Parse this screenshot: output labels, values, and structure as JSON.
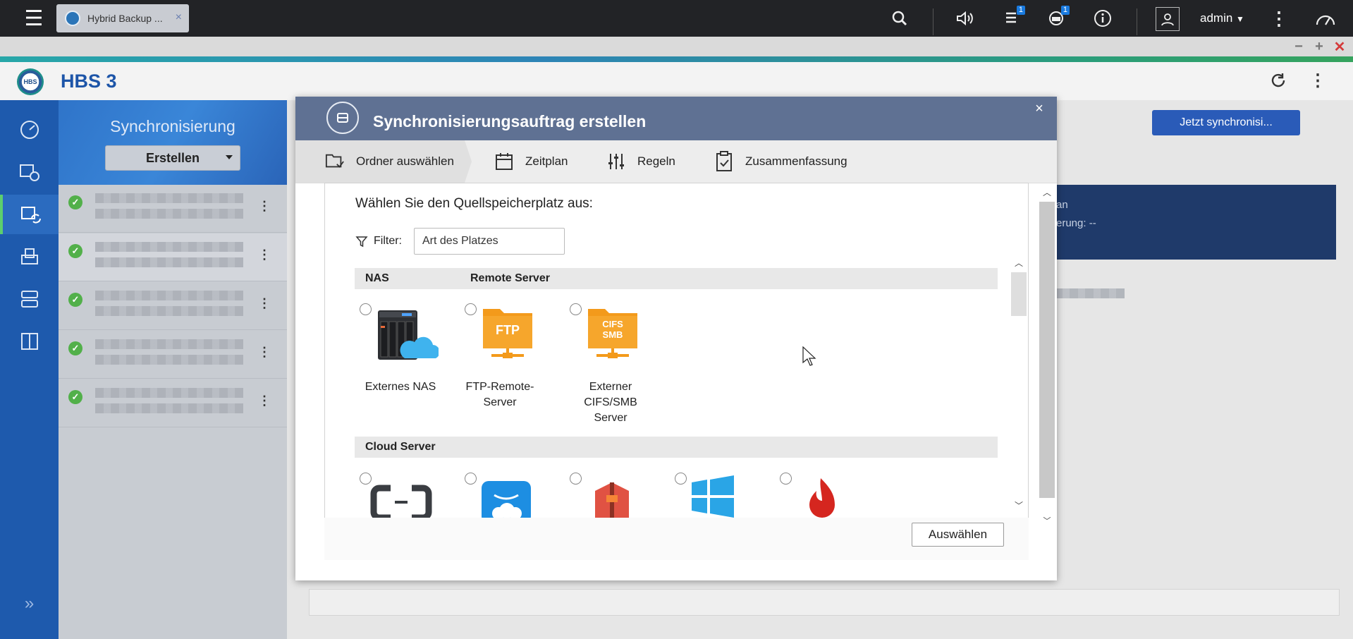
{
  "topbar": {
    "menu_icon": "hamburger-menu-icon",
    "tab_label": "Hybrid Backup ...",
    "tab_close": "×",
    "notifications": [
      {
        "icon": "tasks-icon",
        "count": "1"
      },
      {
        "icon": "event-icon",
        "count": "1"
      }
    ],
    "user": "admin"
  },
  "window_controls": {
    "minimize": "−",
    "maximize": "+",
    "close": "✕"
  },
  "app": {
    "logo_text": "HBS",
    "title": "HBS 3"
  },
  "left_nav": [
    "overview-icon",
    "backup-restore-icon",
    "sync-icon",
    "services-icon",
    "storage-spaces-icon",
    "logs-icon"
  ],
  "side_panel": {
    "title": "Synchronisierung",
    "create_button": "Erstellen",
    "jobs_count": 5
  },
  "main": {
    "sync_now_button": "Jetzt synchronisi...",
    "info_line1": "an",
    "info_line2": "erung: --"
  },
  "dialog": {
    "title": "Synchronisierungsauftrag erstellen",
    "close": "×",
    "steps": [
      {
        "label": "Ordner auswählen",
        "active": true
      },
      {
        "label": "Zeitplan",
        "active": false
      },
      {
        "label": "Regeln",
        "active": false
      },
      {
        "label": "Zusammenfassung",
        "active": false
      }
    ],
    "prompt": "Wählen Sie den Quellspeicherplatz aus:",
    "filter_label": "Filter:",
    "filter_value": "Art des Platzes",
    "sections": {
      "nas": "NAS",
      "remote": "Remote Server",
      "cloud": "Cloud Server"
    },
    "options": [
      {
        "label": "Externes NAS",
        "icon": "external-nas-icon"
      },
      {
        "label": "FTP-Remote-Server",
        "icon": "ftp-folder-icon",
        "badge": "FTP"
      },
      {
        "label": "Externer CIFS/SMB Server",
        "icon": "cifs-smb-folder-icon",
        "badge_line1": "CIFS",
        "badge_line2": "SMB"
      }
    ],
    "cloud_options": [
      "alibaba-cloud-icon",
      "amazon-drive-icon",
      "amazon-s3-icon",
      "azure-icon",
      "backblaze-icon"
    ],
    "select_button": "Auswählen"
  },
  "colors": {
    "accent": "#2a5bb8",
    "nav": "#1e5aad",
    "dialog_header": "#5f7193",
    "folder_orange": "#f39a1b"
  }
}
